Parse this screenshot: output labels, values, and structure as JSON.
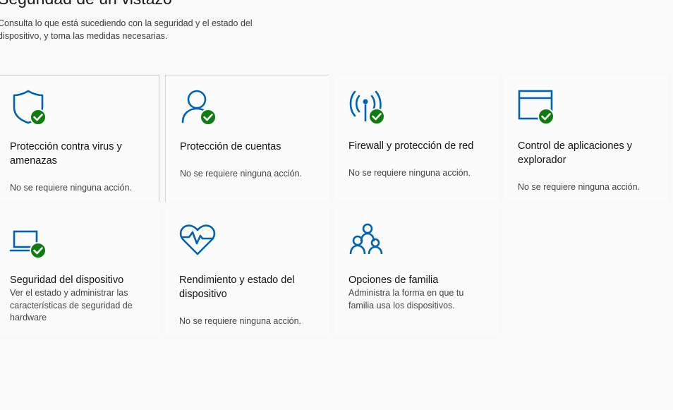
{
  "header": {
    "title": "Seguridad de un vistazo",
    "subtitle": "Consulta lo que está sucediendo con la seguridad y el estado del dispositivo, y toma las medidas necesarias."
  },
  "tiles": [
    {
      "title": "Protección contra virus y amenazas",
      "status": "No se requiere ninguna acción.",
      "icon": "shield-icon",
      "badge": "check-icon"
    },
    {
      "title": "Protección de cuentas",
      "status": "No se requiere ninguna acción.",
      "icon": "person-icon",
      "badge": "check-icon"
    },
    {
      "title": "Firewall y protección de red",
      "status": "No se requiere ninguna acción.",
      "icon": "antenna-icon",
      "badge": "check-icon"
    },
    {
      "title": "Control de aplicaciones y explorador",
      "status": "No se requiere ninguna acción.",
      "icon": "browser-window-icon",
      "badge": "check-icon"
    },
    {
      "title": "Seguridad del dispositivo",
      "status": "Ver el estado y administrar las características de seguridad de hardware",
      "icon": "laptop-icon",
      "badge": "check-icon"
    },
    {
      "title": "Rendimiento y estado del dispositivo",
      "status": "No se requiere ninguna acción.",
      "icon": "heart-pulse-icon"
    },
    {
      "title": "Opciones de familia",
      "status": "Administra la forma en que tu familia usa los dispositivos.",
      "icon": "family-icon"
    }
  ],
  "colors": {
    "accent": "#0063b1",
    "success": "#107c10",
    "background": "#f9f9f9",
    "tile": "#fbfbfb"
  }
}
